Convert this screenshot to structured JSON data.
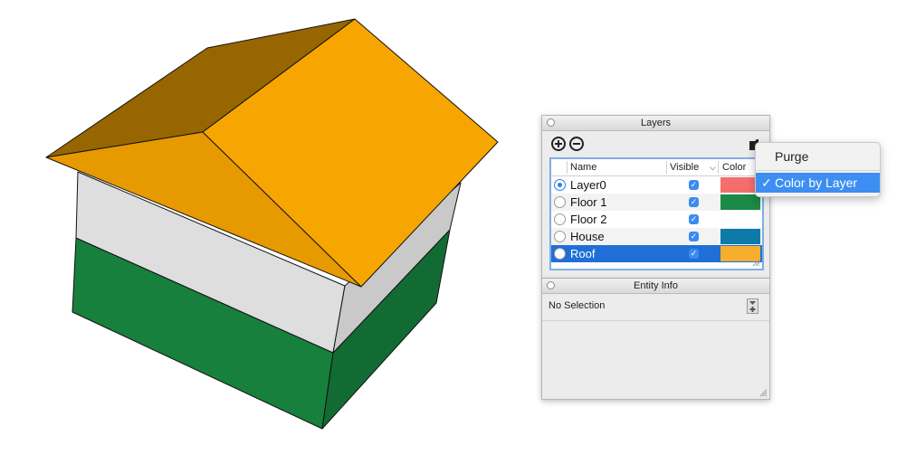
{
  "layers_panel": {
    "title": "Layers",
    "columns": {
      "name": "Name",
      "visible": "Visible",
      "color": "Color"
    },
    "rows": [
      {
        "name": "Layer0",
        "active": true,
        "visible": true,
        "color": "#f56e6e",
        "selected": false
      },
      {
        "name": "Floor 1",
        "active": false,
        "visible": true,
        "color": "#1a8a46",
        "selected": false
      },
      {
        "name": "Floor 2",
        "active": false,
        "visible": true,
        "color": "#ffffff",
        "selected": false
      },
      {
        "name": "House",
        "active": false,
        "visible": true,
        "color": "#0e7aa8",
        "selected": false
      },
      {
        "name": "Roof",
        "active": false,
        "visible": true,
        "color": "#f7ae2e",
        "selected": true
      }
    ]
  },
  "entity_info_panel": {
    "title": "Entity Info",
    "selection_text": "No Selection"
  },
  "context_menu": {
    "items": [
      {
        "label": "Purge",
        "checked": false
      },
      {
        "label": "Color by Layer",
        "checked": true
      }
    ],
    "check_glyph": "✓"
  },
  "model_colors": {
    "roof_light": "#f7a500",
    "roof_mid": "#e69a00",
    "roof_dark": "#976600",
    "wall_upper_front": "#dedede",
    "wall_upper_side": "#c9c9c9",
    "wall_lower_front": "#17803c",
    "wall_lower_side": "#136b34"
  }
}
